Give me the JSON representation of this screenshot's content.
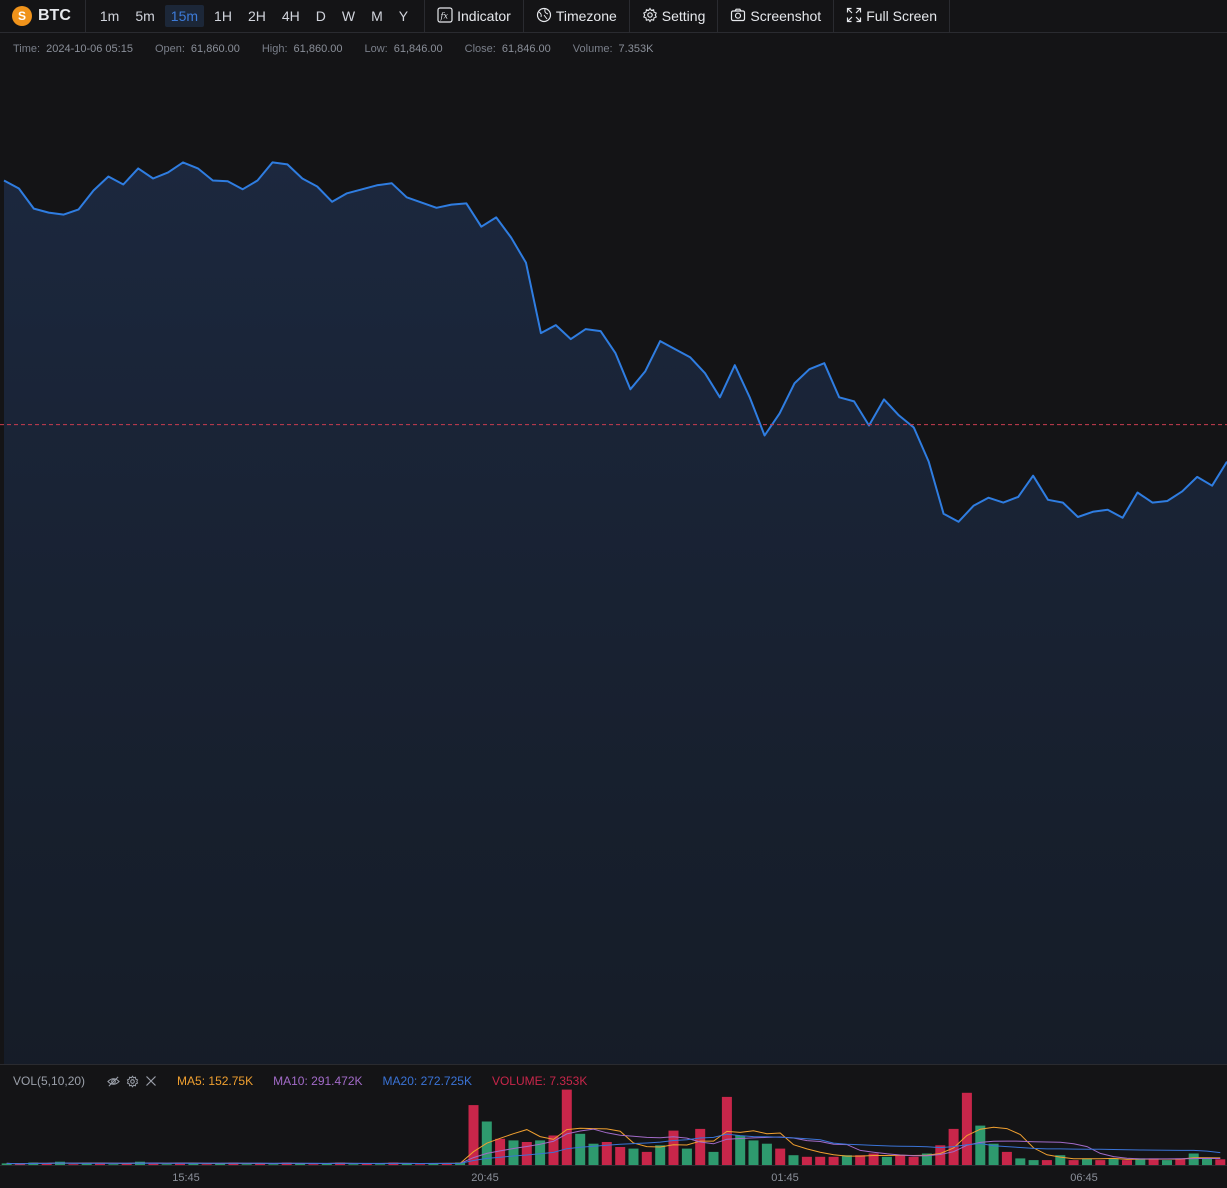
{
  "toolbar": {
    "symbol": "BTC",
    "coin_glyph": "S",
    "periods": [
      "1m",
      "5m",
      "15m",
      "1H",
      "2H",
      "4H",
      "D",
      "W",
      "M",
      "Y"
    ],
    "active_period": "15m",
    "tools": {
      "indicator": "Indicator",
      "timezone": "Timezone",
      "setting": "Setting",
      "screenshot": "Screenshot",
      "fullscreen": "Full Screen"
    }
  },
  "legend": {
    "time_label": "Time:",
    "time": "2024-10-06 05:15",
    "open_label": "Open:",
    "open": "61,860.00",
    "high_label": "High:",
    "high": "61,860.00",
    "low_label": "Low:",
    "low": "61,846.00",
    "close_label": "Close:",
    "close": "61,846.00",
    "volume_label": "Volume:",
    "volume": "7.353K"
  },
  "volume_legend": {
    "name": "VOL(5,10,20)",
    "ma5_label": "MA5:",
    "ma5": "152.75K",
    "ma10_label": "MA10:",
    "ma10": "291.472K",
    "ma20_label": "MA20:",
    "ma20": "272.725K",
    "volume_label": "VOLUME:",
    "volume": "7.353K"
  },
  "colors": {
    "line": "#2f7de1",
    "up": "#2e9a6e",
    "down": "#c8264a",
    "ma5": "#f0a030",
    "ma10": "#a26bc8",
    "ma20": "#3a73d6",
    "last_price_line": "#c83c50"
  },
  "chart_data": {
    "type": "line",
    "title": "",
    "price": [
      61400,
      61380,
      61330,
      61320,
      61315,
      61328,
      61375,
      61410,
      61390,
      61430,
      61405,
      61420,
      61445,
      61430,
      61400,
      61398,
      61378,
      61400,
      61445,
      61440,
      61405,
      61385,
      61347,
      61368,
      61378,
      61388,
      61393,
      61358,
      61345,
      61332,
      61340,
      61343,
      61285,
      61308,
      61258,
      61195,
      61020,
      61040,
      61005,
      61030,
      61025,
      60970,
      60880,
      60925,
      61000,
      60980,
      60960,
      60920,
      60860,
      60940,
      60860,
      60765,
      60820,
      60895,
      60930,
      60945,
      60860,
      60850,
      60790,
      60855,
      60815,
      60785,
      60700,
      60570,
      60550,
      60590,
      60610,
      60598,
      60612,
      60665,
      60605,
      60598,
      60562,
      60575,
      60580,
      60560,
      60623,
      60598,
      60602,
      60626,
      60662,
      60640,
      60700
    ],
    "last_price": 60792,
    "x_ticks": [
      "15:45",
      "20:45",
      "01:45",
      "06:45"
    ],
    "volume": {
      "values": [
        2,
        1,
        3,
        2,
        4,
        1,
        2,
        3,
        1,
        2,
        4,
        2,
        1,
        3,
        2,
        1,
        2,
        3,
        1,
        2,
        1,
        3,
        2,
        1,
        2,
        3,
        1,
        2,
        1,
        3,
        2,
        1,
        2,
        2,
        3,
        73,
        53,
        32,
        30,
        28,
        30,
        36,
        92,
        38,
        26,
        28,
        22,
        20,
        16,
        24,
        42,
        20,
        44,
        16,
        83,
        36,
        30,
        26,
        20,
        12,
        10,
        10,
        10,
        12,
        12,
        14,
        10,
        12,
        10,
        14,
        24,
        44,
        88,
        48,
        26,
        16,
        8,
        6,
        6,
        12,
        6,
        8,
        6,
        8,
        6,
        8,
        8,
        6,
        8,
        14,
        8,
        7
      ],
      "direction": [
        "u",
        "d",
        "u",
        "d",
        "u",
        "d",
        "u",
        "d",
        "u",
        "d",
        "u",
        "d",
        "u",
        "d",
        "u",
        "d",
        "u",
        "d",
        "u",
        "d",
        "u",
        "d",
        "u",
        "d",
        "u",
        "d",
        "u",
        "d",
        "u",
        "d",
        "u",
        "d",
        "u",
        "d",
        "u",
        "d",
        "u",
        "d",
        "u",
        "d",
        "u",
        "d",
        "d",
        "u",
        "u",
        "d",
        "d",
        "u",
        "d",
        "u",
        "d",
        "u",
        "d",
        "u",
        "d",
        "u",
        "u",
        "u",
        "d",
        "u",
        "d",
        "d",
        "d",
        "u",
        "d",
        "d",
        "u",
        "d",
        "d",
        "u",
        "d",
        "d",
        "d",
        "u",
        "u",
        "d",
        "u",
        "u",
        "d",
        "u",
        "d",
        "u",
        "d",
        "u",
        "d",
        "u",
        "d",
        "u",
        "d",
        "u",
        "u",
        "d"
      ]
    }
  }
}
